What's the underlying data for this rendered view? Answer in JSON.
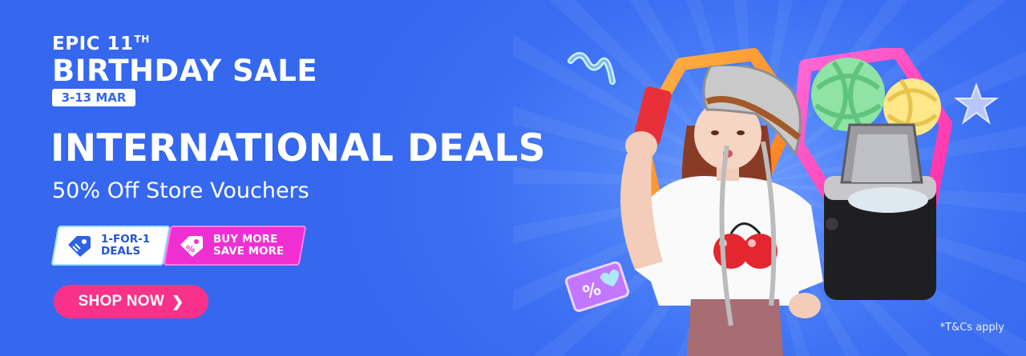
{
  "promo": {
    "event_line1": "EPIC 11",
    "event_line1_sup": "TH",
    "event_line2": "BIRTHDAY SALE",
    "dates": "3-13 MAR",
    "headline": "INTERNATIONAL DEALS",
    "subhead": "50% Off Store Vouchers",
    "badges": [
      {
        "label_line1": "1-FOR-1",
        "label_line2": "DEALS",
        "icon": "tag-icon"
      },
      {
        "label_line1": "BUY MORE",
        "label_line2": "SAVE MORE",
        "icon": "tag-icon"
      }
    ],
    "cta_label": "SHOP NOW",
    "cta_icon": "chevron-right-icon",
    "terms": "*T&Cs apply"
  },
  "colors": {
    "background": "#3a6ff3",
    "cta": "#f8328b",
    "badge_pink": "#f02fd2",
    "badge_white": "#ffffff",
    "accent_text": "#3565ef"
  }
}
